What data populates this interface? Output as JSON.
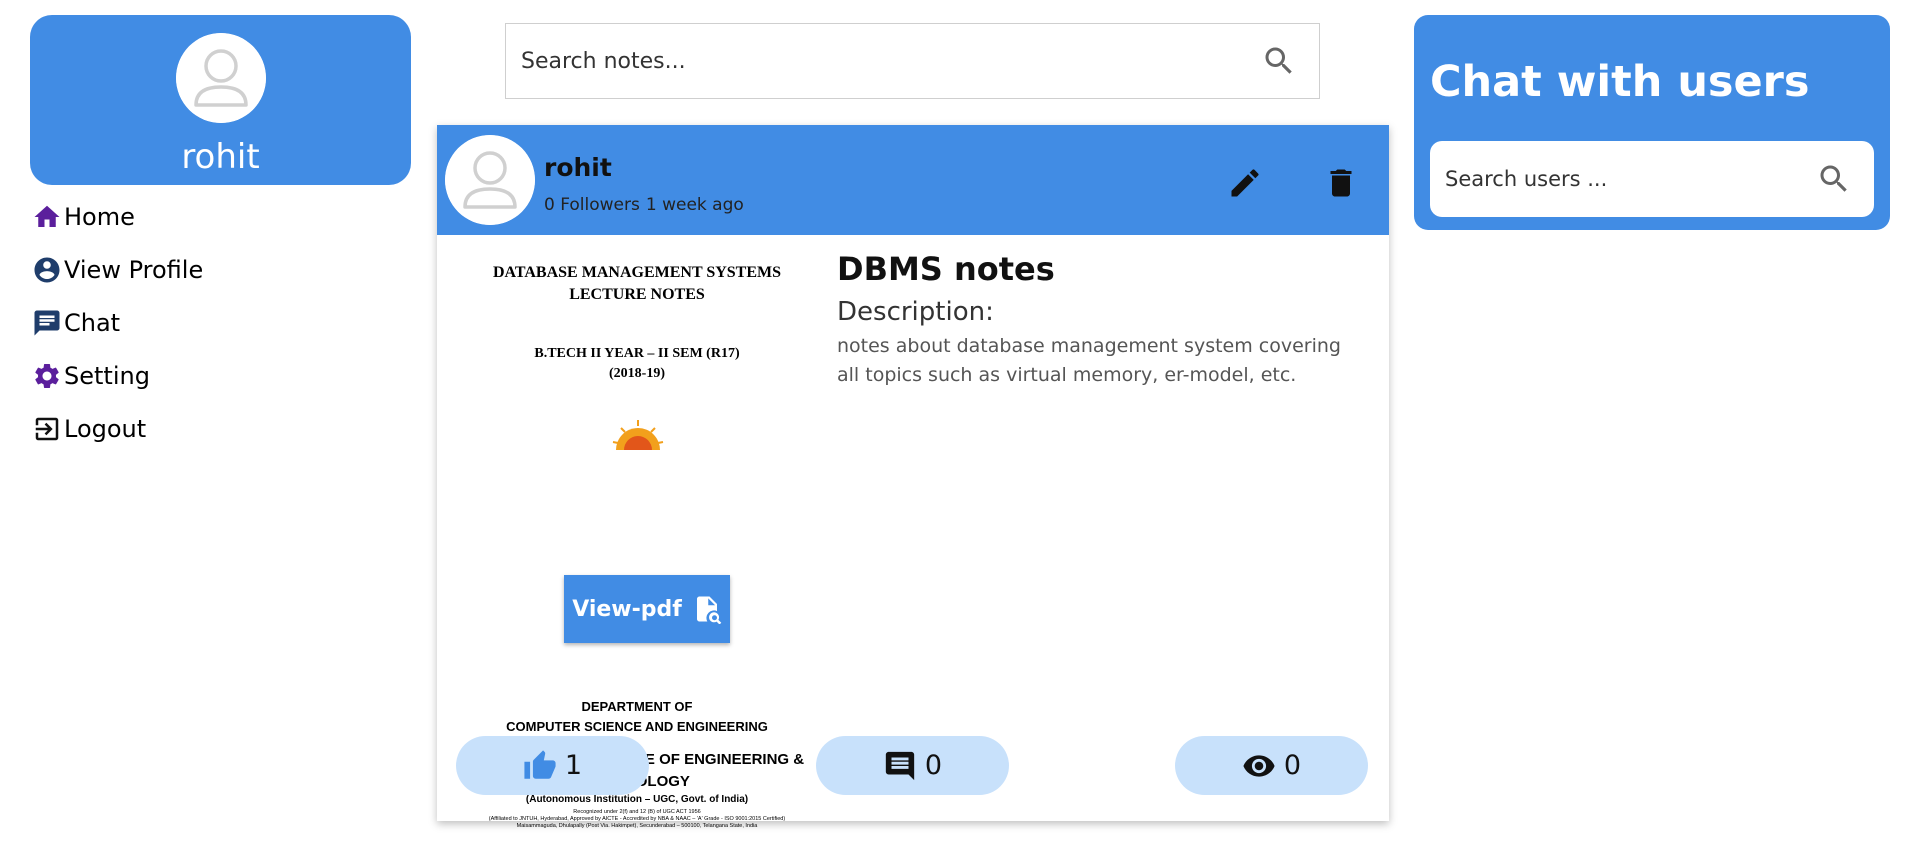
{
  "profile": {
    "username": "rohit",
    "avatar_icon": "user-avatar-icon"
  },
  "nav": {
    "items": [
      {
        "label": "Home",
        "icon": "home-icon",
        "color": "#5b1f9c"
      },
      {
        "label": "View Profile",
        "icon": "account-circle-icon",
        "color": "#1f3d6b"
      },
      {
        "label": "Chat",
        "icon": "chat-icon",
        "color": "#1f3d6b"
      },
      {
        "label": "Setting",
        "icon": "gear-icon",
        "color": "#5b1f9c"
      },
      {
        "label": "Logout",
        "icon": "logout-icon",
        "color": "#111111"
      }
    ]
  },
  "search": {
    "placeholder": "Search notes..."
  },
  "note": {
    "author": "rohit",
    "followers": "0 Followers",
    "time_ago": "1 week ago",
    "title": "DBMS notes",
    "description_label": "Description:",
    "description": "notes about database management system covering all topics such as virtual memory, er-model, etc.",
    "view_pdf_label": "View-pdf",
    "likes": "1",
    "comments": "0",
    "views": "0",
    "pdf_preview": {
      "title_line1": "DATABASE MANAGEMENT SYSTEMS",
      "title_line2": "LECTURE NOTES",
      "year_line1": "B.TECH II YEAR – II SEM (R17)",
      "year_line2": "(2018-19)",
      "dept_line1": "DEPARTMENT OF",
      "dept_line2": "COMPUTER SCIENCE AND ENGINEERING",
      "college_line1": "MALLA REDDY COLLEGE OF ENGINEERING &",
      "college_line2": "TECHNOLOGY",
      "autonomous": "(Autonomous Institution – UGC, Govt. of India)",
      "fine_line1": "Recognized under 2(f) and 12 (B) of UGC ACT 1956",
      "fine_line2": "(Affiliated to JNTUH, Hyderabad, Approved by AICTE - Accredited by NBA & NAAC – 'A' Grade - ISO 9001:2015 Certified)",
      "fine_line3": "Maisammaguda, Dhulapally (Post Via. Hakimpet), Secunderabad – 500100, Telangana State, India"
    }
  },
  "chat": {
    "title": "Chat with users",
    "search_placeholder": "Search users ..."
  },
  "colors": {
    "primary": "#418ce4",
    "pill": "#c8e1fb",
    "like_icon": "#418ce4"
  }
}
